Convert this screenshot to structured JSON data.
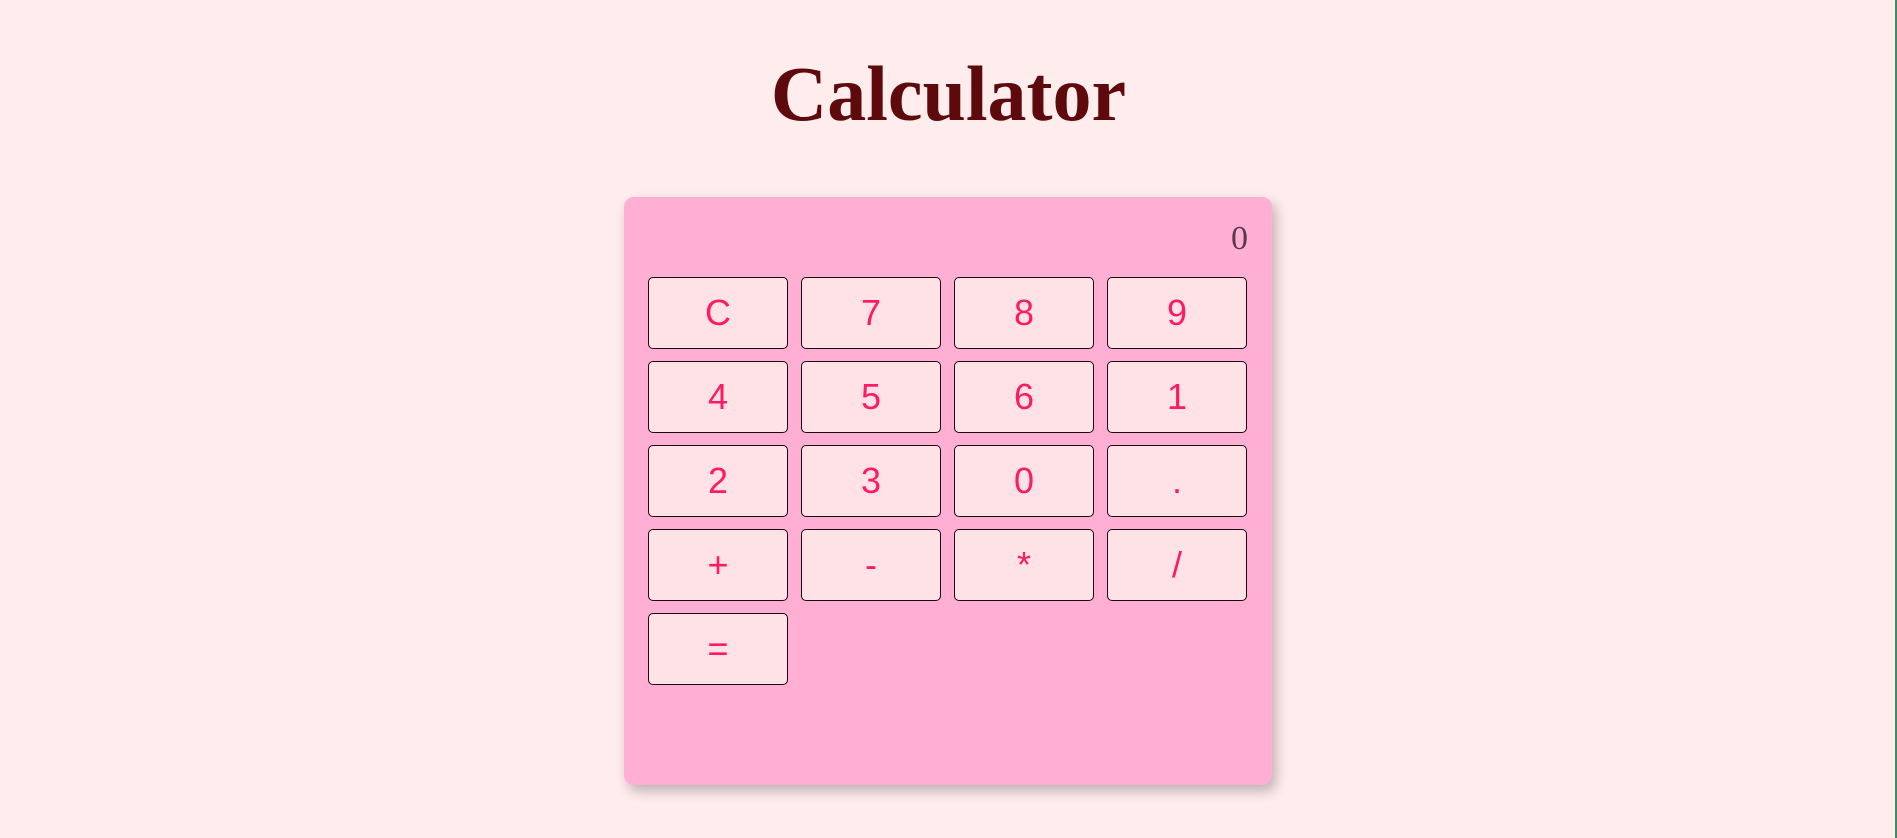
{
  "title": "Calculator",
  "display": {
    "value": "0"
  },
  "keys": [
    "C",
    "7",
    "8",
    "9",
    "4",
    "5",
    "6",
    "1",
    "2",
    "3",
    "0",
    ".",
    "+",
    "-",
    "*",
    "/",
    "="
  ],
  "colors": {
    "page_background": "#ffeced",
    "calculator_background": "#ffaed4",
    "key_background": "#ffe2e6",
    "key_text": "#ff1a66",
    "title_text": "#5e0a0c"
  }
}
